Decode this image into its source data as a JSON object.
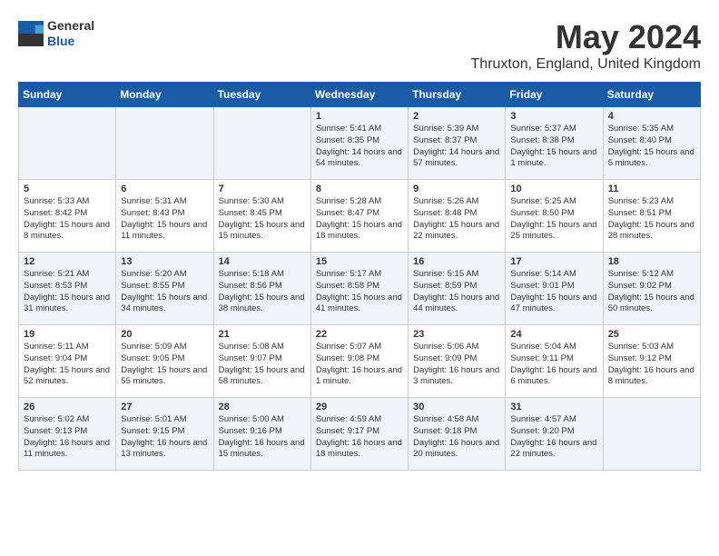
{
  "header": {
    "logo": {
      "general": "General",
      "blue": "Blue"
    },
    "title": "May 2024",
    "location": "Thruxton, England, United Kingdom"
  },
  "days_of_week": [
    "Sunday",
    "Monday",
    "Tuesday",
    "Wednesday",
    "Thursday",
    "Friday",
    "Saturday"
  ],
  "weeks": [
    [
      {
        "day": "",
        "content": ""
      },
      {
        "day": "",
        "content": ""
      },
      {
        "day": "",
        "content": ""
      },
      {
        "day": "1",
        "content": "Sunrise: 5:41 AM\nSunset: 8:35 PM\nDaylight: 14 hours\nand 54 minutes."
      },
      {
        "day": "2",
        "content": "Sunrise: 5:39 AM\nSunset: 8:37 PM\nDaylight: 14 hours\nand 57 minutes."
      },
      {
        "day": "3",
        "content": "Sunrise: 5:37 AM\nSunset: 8:38 PM\nDaylight: 15 hours\nand 1 minute."
      },
      {
        "day": "4",
        "content": "Sunrise: 5:35 AM\nSunset: 8:40 PM\nDaylight: 15 hours\nand 5 minutes."
      }
    ],
    [
      {
        "day": "5",
        "content": "Sunrise: 5:33 AM\nSunset: 8:42 PM\nDaylight: 15 hours\nand 8 minutes."
      },
      {
        "day": "6",
        "content": "Sunrise: 5:31 AM\nSunset: 8:43 PM\nDaylight: 15 hours\nand 11 minutes."
      },
      {
        "day": "7",
        "content": "Sunrise: 5:30 AM\nSunset: 8:45 PM\nDaylight: 15 hours\nand 15 minutes."
      },
      {
        "day": "8",
        "content": "Sunrise: 5:28 AM\nSunset: 8:47 PM\nDaylight: 15 hours\nand 18 minutes."
      },
      {
        "day": "9",
        "content": "Sunrise: 5:26 AM\nSunset: 8:48 PM\nDaylight: 15 hours\nand 22 minutes."
      },
      {
        "day": "10",
        "content": "Sunrise: 5:25 AM\nSunset: 8:50 PM\nDaylight: 15 hours\nand 25 minutes."
      },
      {
        "day": "11",
        "content": "Sunrise: 5:23 AM\nSunset: 8:51 PM\nDaylight: 15 hours\nand 28 minutes."
      }
    ],
    [
      {
        "day": "12",
        "content": "Sunrise: 5:21 AM\nSunset: 8:53 PM\nDaylight: 15 hours\nand 31 minutes."
      },
      {
        "day": "13",
        "content": "Sunrise: 5:20 AM\nSunset: 8:55 PM\nDaylight: 15 hours\nand 34 minutes."
      },
      {
        "day": "14",
        "content": "Sunrise: 5:18 AM\nSunset: 8:56 PM\nDaylight: 15 hours\nand 38 minutes."
      },
      {
        "day": "15",
        "content": "Sunrise: 5:17 AM\nSunset: 8:58 PM\nDaylight: 15 hours\nand 41 minutes."
      },
      {
        "day": "16",
        "content": "Sunrise: 5:15 AM\nSunset: 8:59 PM\nDaylight: 15 hours\nand 44 minutes."
      },
      {
        "day": "17",
        "content": "Sunrise: 5:14 AM\nSunset: 9:01 PM\nDaylight: 15 hours\nand 47 minutes."
      },
      {
        "day": "18",
        "content": "Sunrise: 5:12 AM\nSunset: 9:02 PM\nDaylight: 15 hours\nand 50 minutes."
      }
    ],
    [
      {
        "day": "19",
        "content": "Sunrise: 5:11 AM\nSunset: 9:04 PM\nDaylight: 15 hours\nand 52 minutes."
      },
      {
        "day": "20",
        "content": "Sunrise: 5:09 AM\nSunset: 9:05 PM\nDaylight: 15 hours\nand 55 minutes."
      },
      {
        "day": "21",
        "content": "Sunrise: 5:08 AM\nSunset: 9:07 PM\nDaylight: 15 hours\nand 58 minutes."
      },
      {
        "day": "22",
        "content": "Sunrise: 5:07 AM\nSunset: 9:08 PM\nDaylight: 16 hours\nand 1 minute."
      },
      {
        "day": "23",
        "content": "Sunrise: 5:06 AM\nSunset: 9:09 PM\nDaylight: 16 hours\nand 3 minutes."
      },
      {
        "day": "24",
        "content": "Sunrise: 5:04 AM\nSunset: 9:11 PM\nDaylight: 16 hours\nand 6 minutes."
      },
      {
        "day": "25",
        "content": "Sunrise: 5:03 AM\nSunset: 9:12 PM\nDaylight: 16 hours\nand 8 minutes."
      }
    ],
    [
      {
        "day": "26",
        "content": "Sunrise: 5:02 AM\nSunset: 9:13 PM\nDaylight: 16 hours\nand 11 minutes."
      },
      {
        "day": "27",
        "content": "Sunrise: 5:01 AM\nSunset: 9:15 PM\nDaylight: 16 hours\nand 13 minutes."
      },
      {
        "day": "28",
        "content": "Sunrise: 5:00 AM\nSunset: 9:16 PM\nDaylight: 16 hours\nand 15 minutes."
      },
      {
        "day": "29",
        "content": "Sunrise: 4:59 AM\nSunset: 9:17 PM\nDaylight: 16 hours\nand 18 minutes."
      },
      {
        "day": "30",
        "content": "Sunrise: 4:58 AM\nSunset: 9:18 PM\nDaylight: 16 hours\nand 20 minutes."
      },
      {
        "day": "31",
        "content": "Sunrise: 4:57 AM\nSunset: 9:20 PM\nDaylight: 16 hours\nand 22 minutes."
      },
      {
        "day": "",
        "content": ""
      }
    ]
  ]
}
